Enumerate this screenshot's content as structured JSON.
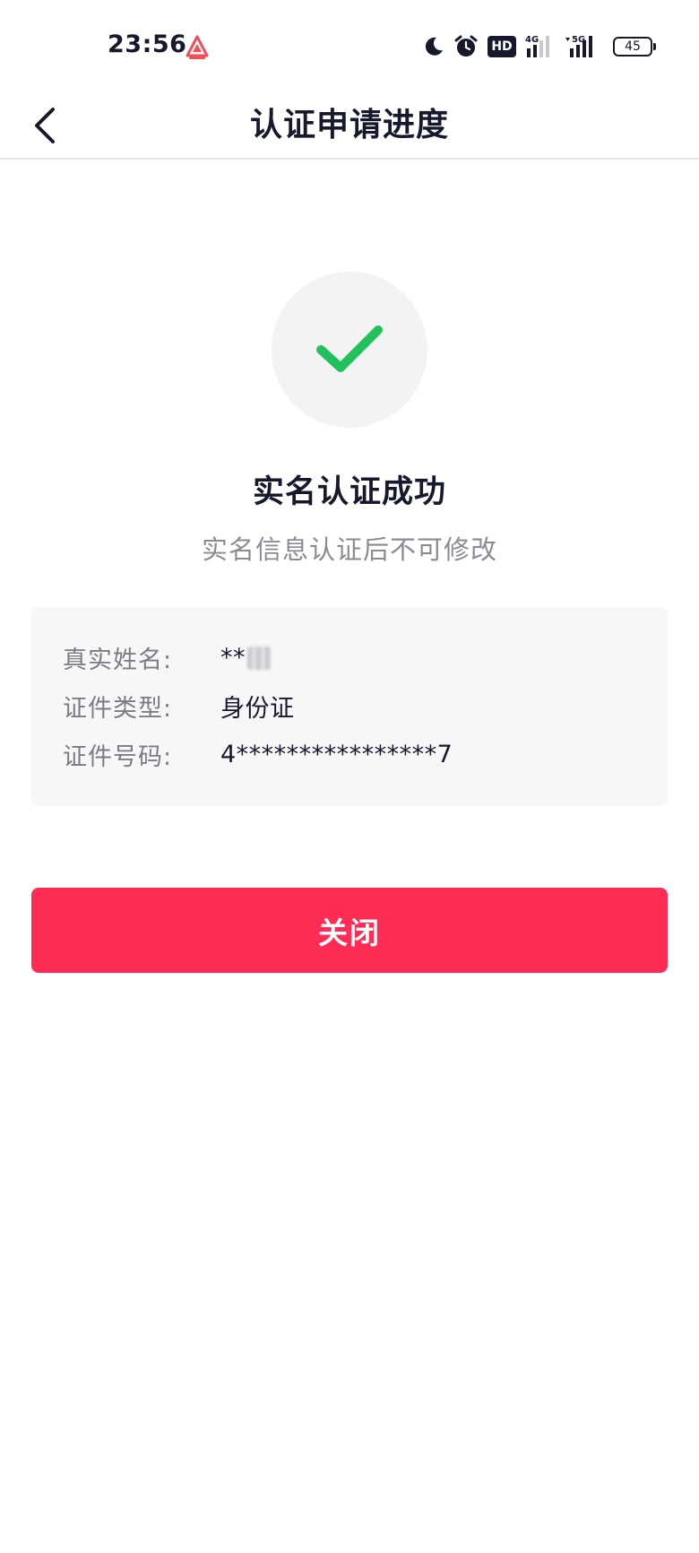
{
  "status_bar": {
    "time": "23:56",
    "app_icon": "triangle-app-icon",
    "icons": [
      "moon-icon",
      "alarm-icon",
      "hd-icon",
      "signal-4g-icon",
      "signal-5g-icon",
      "battery-icon"
    ],
    "hd_label": "HD",
    "battery_level": "45"
  },
  "nav": {
    "back_icon": "chevron-left-icon",
    "title": "认证申请进度"
  },
  "result": {
    "icon": "checkmark-icon",
    "check_color": "#20c15b",
    "title": "实名认证成功",
    "subtitle": "实名信息认证后不可修改"
  },
  "info": {
    "rows": [
      {
        "label": "真实姓名:",
        "value": "**"
      },
      {
        "label": "证件类型:",
        "value": "身份证"
      },
      {
        "label": "证件号码:",
        "value": "4****************7"
      }
    ]
  },
  "actions": {
    "close_label": "关闭",
    "primary_color": "#fe2c55"
  }
}
